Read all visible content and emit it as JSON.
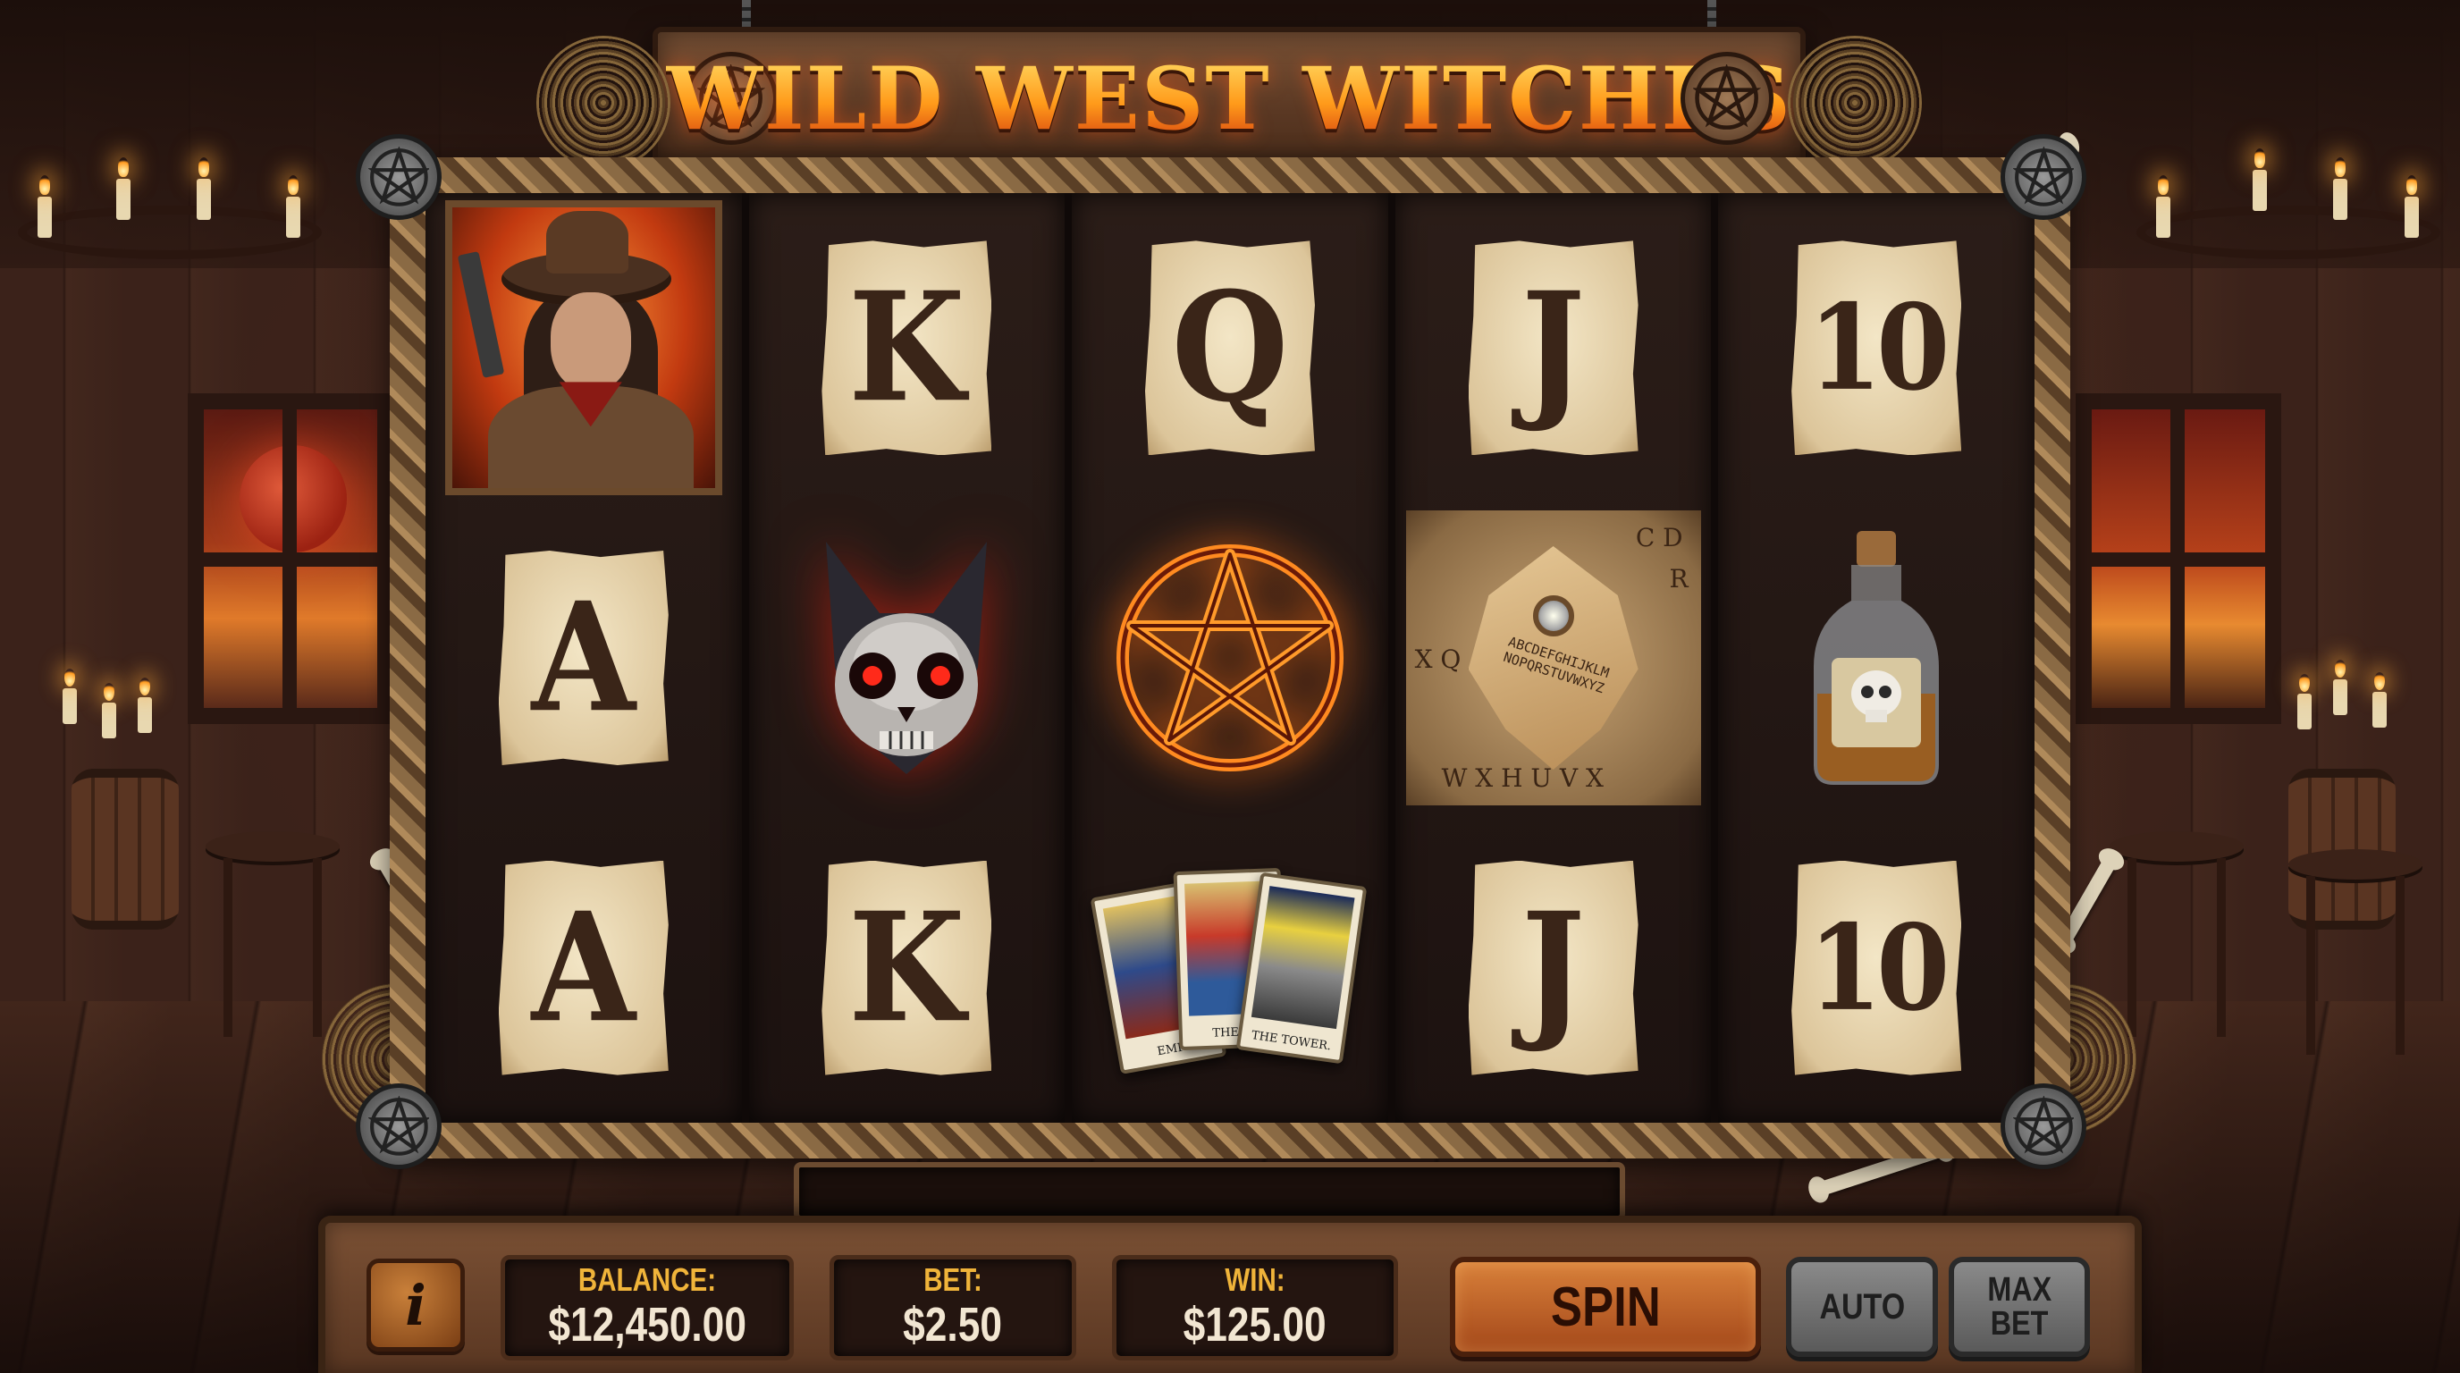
{
  "game": {
    "title": "WILD WEST WITCHES"
  },
  "reels": [
    [
      "cowgirl-witch",
      "A",
      "A"
    ],
    [
      "K",
      "cat-skull",
      "K"
    ],
    [
      "Q",
      "fire-pentagram",
      "tarot-cards"
    ],
    [
      "J",
      "ouija-board",
      "J"
    ],
    [
      "10",
      "poison-bottle",
      "10"
    ]
  ],
  "symbols": {
    "ouija_letters_top": "C D",
    "ouija_letters_left": "X Q",
    "ouija_letters_right": "R",
    "ouija_letters_bottom": "W X H U V X",
    "planchette_text": "ABCDEFGHIJKLM NOPQRSTUVWXYZ",
    "tarot_1": "EMP",
    "tarot_2": "THE H",
    "tarot_3": "THE TOWER."
  },
  "controls": {
    "info_label": "i",
    "balance_label": "BALANCE:",
    "balance_value": "$12,450.00",
    "bet_label": "BET:",
    "bet_value": "$2.50",
    "win_label": "WIN:",
    "win_value": "$125.00",
    "spin_label": "SPIN",
    "auto_label": "AUTO",
    "maxbet_line1": "MAX",
    "maxbet_line2": "BET"
  },
  "colors": {
    "title_gold": "#ffb020",
    "meter_label": "#f0b43a",
    "spin_button": "#c4692c",
    "gray_button": "#7a7a7a"
  }
}
